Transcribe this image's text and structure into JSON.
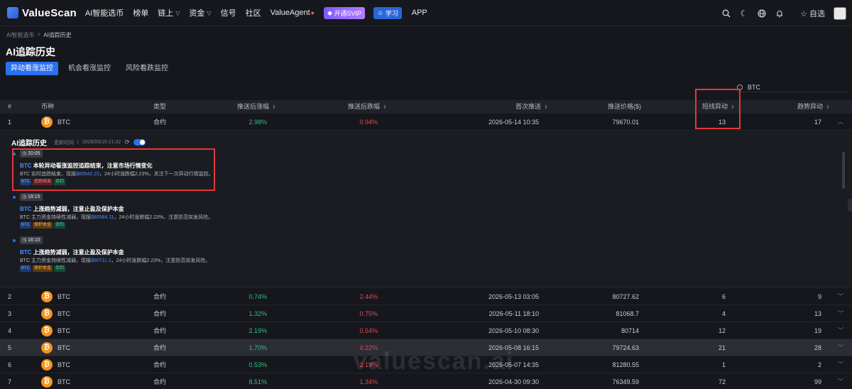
{
  "brand": {
    "name": "ValueScan"
  },
  "nav": {
    "items": [
      "AI智能选币",
      "榜单",
      "链上",
      "资金",
      "信号",
      "社区",
      "ValueAgent"
    ],
    "vip_label": "开通SVIP",
    "learn_label": "学习",
    "app_label": "APP",
    "favorites_label": "自选",
    "icons": [
      "search-icon",
      "moon-icon",
      "globe-icon",
      "bell-icon",
      "star-icon"
    ]
  },
  "breadcrumb": {
    "root": "AI智能选币",
    "separator": ">",
    "current": "AI追踪历史"
  },
  "page": {
    "title": "AI追踪历史"
  },
  "tabs": [
    "异动看涨监控",
    "机会看涨监控",
    "风险看跌监控"
  ],
  "search": {
    "value": "BTC"
  },
  "table": {
    "headers": {
      "index": "#",
      "coin": "币种",
      "type": "类型",
      "post_rise": "推送后涨幅",
      "post_fall": "推送后跌幅",
      "first_push": "首次推送",
      "push_price": "推送价格($)",
      "short_anomaly": "短线异动",
      "trend_anomaly": "趋势异动"
    },
    "rows": [
      {
        "index": "1",
        "coin": "BTC",
        "type": "合约",
        "rise": "2.98%",
        "fall": "0.94%",
        "first": "2026-05-14 10:35",
        "price": "79670.01",
        "short": "13",
        "trend": "17"
      },
      {
        "index": "2",
        "coin": "BTC",
        "type": "合约",
        "rise": "0.74%",
        "fall": "2.44%",
        "first": "2026-05-13 03:05",
        "price": "80727.62",
        "short": "6",
        "trend": "9"
      },
      {
        "index": "3",
        "coin": "BTC",
        "type": "合约",
        "rise": "1.32%",
        "fall": "0.75%",
        "first": "2026-05-11 18:10",
        "price": "81068.7",
        "short": "4",
        "trend": "13"
      },
      {
        "index": "4",
        "coin": "BTC",
        "type": "合约",
        "rise": "2.19%",
        "fall": "0.54%",
        "first": "2026-05-10 08:30",
        "price": "80714",
        "short": "12",
        "trend": "19"
      },
      {
        "index": "5",
        "coin": "BTC",
        "type": "合约",
        "rise": "1.70%",
        "fall": "0.22%",
        "first": "2026-05-08 16:15",
        "price": "79724.63",
        "short": "21",
        "trend": "28"
      },
      {
        "index": "6",
        "coin": "BTC",
        "type": "合约",
        "rise": "0.53%",
        "fall": "2.19%",
        "first": "2026-05-07 14:35",
        "price": "81280.55",
        "short": "1",
        "trend": "2"
      },
      {
        "index": "7",
        "coin": "BTC",
        "type": "合约",
        "rise": "8.51%",
        "fall": "1.34%",
        "first": "2026-04-30 09:30",
        "price": "76349.59",
        "short": "72",
        "trend": "99"
      }
    ]
  },
  "panel": {
    "title": "AI追踪历史",
    "updated_label": "更新时间",
    "updated_value": "2026/05/15 21:32",
    "entries": [
      {
        "time": "20:05",
        "symbol": "BTC",
        "title": "本轮异动看涨监控追踪结束，注意市场行情变化",
        "desc_prefix": "BTC 实时追踪结束，现报",
        "price": "$80542.22",
        "desc_suffix": "，24小时涨跌幅2.23%，关注下一次异动行情监控。",
        "tags": [
          "BTC",
          "追踪结束",
          "合约"
        ]
      },
      {
        "time": "18:15",
        "symbol": "BTC",
        "title": "上涨趋势减弱，注意止盈及保护本金",
        "desc_prefix": "BTC 主力资金持续性减弱，现报",
        "price": "$80584.11",
        "desc_suffix": "，24小时涨跌幅2.23%，注意防范突发风险。",
        "tags": [
          "BTC",
          "保护本金",
          "合约"
        ]
      },
      {
        "time": "16:10",
        "symbol": "BTC",
        "title": "上涨趋势减弱，注意止盈及保护本金",
        "desc_prefix": "BTC 主力资金持续性减弱，现报",
        "price": "$80711.2",
        "desc_suffix": "，24小时涨跌幅2.23%，注意防范突发风险。",
        "tags": [
          "BTC",
          "保护本金",
          "合约"
        ]
      }
    ]
  },
  "watermark": "valuescan.ai"
}
